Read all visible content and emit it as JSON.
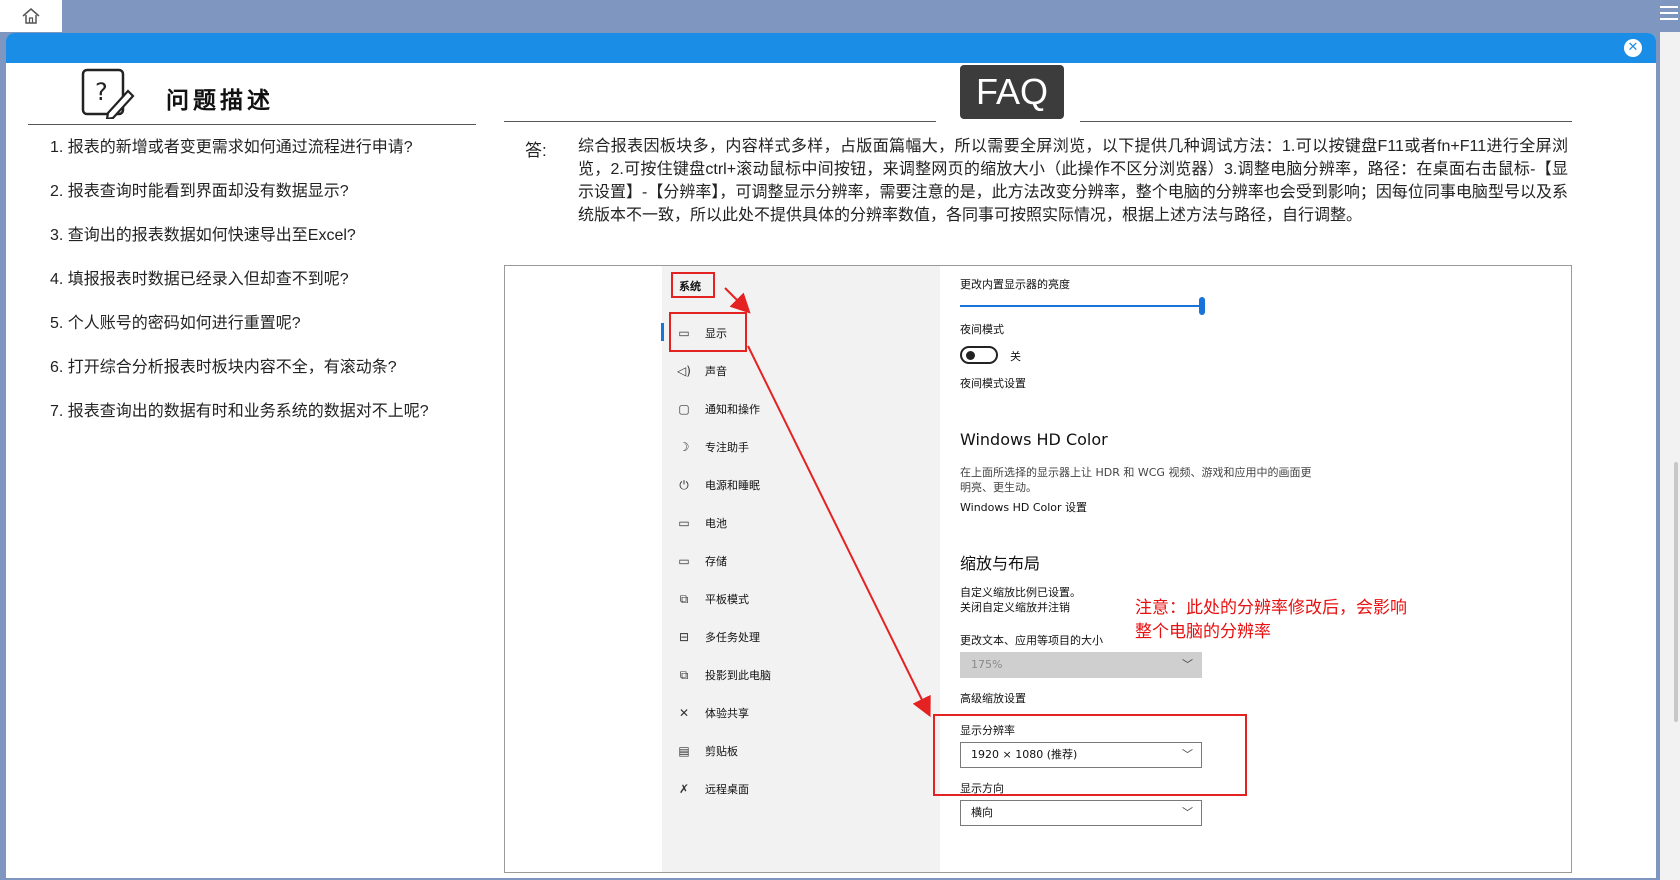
{
  "topbar": {
    "home_icon": "home-icon",
    "menu_icon": "hamburger-menu-icon"
  },
  "modal": {
    "close_icon": "close-icon",
    "close_glyph": "✕"
  },
  "questions": {
    "title": "问题描述",
    "icon": "question-note-icon",
    "items": [
      "1. 报表的新增或者变更需求如何通过流程进行申请?",
      "2. 报表查询时能看到界面却没有数据显示?",
      "3. 查询出的报表数据如何快速导出至Excel?",
      "4. 填报报表时数据已经录入但却查不到呢?",
      "5. 个人账号的密码如何进行重置呢?",
      "6. 打开综合分析报表时板块内容不全，有滚动条?",
      "7. 报表查询出的数据有时和业务系统的数据对不上呢?"
    ]
  },
  "faq": {
    "badge": "FAQ",
    "answer_label": "答:",
    "answer_text": "综合报表因板块多，内容样式多样，占版面篇幅大，所以需要全屏浏览，以下提供几种调试方法：1.可以按键盘F11或者fn+F11进行全屏浏览，2.可按住键盘ctrl+滚动鼠标中间按钮，来调整网页的缩放大小（此操作不区分浏览器）3.调整电脑分辨率，路径：在桌面右击鼠标-【显示设置】-【分辨率】，可调整显示分辨率，需要注意的是，此方法改变分辨率，整个电脑的分辨率也会受到影响；因每位同事电脑型号以及系统版本不一致，所以此处不提供具体的分辨率数值，各同事可按照实际情况，根据上述方法与路径，自行调整。"
  },
  "screenshot": {
    "sidebar_header": "系统",
    "sidebar_items": [
      {
        "label": "显示",
        "icon": "monitor-icon",
        "glyph": "▭"
      },
      {
        "label": "声音",
        "icon": "speaker-icon",
        "glyph": "◁)"
      },
      {
        "label": "通知和操作",
        "icon": "notification-icon",
        "glyph": "▢"
      },
      {
        "label": "专注助手",
        "icon": "moon-icon",
        "glyph": "☽"
      },
      {
        "label": "电源和睡眠",
        "icon": "power-icon",
        "glyph": "⏻"
      },
      {
        "label": "电池",
        "icon": "battery-icon",
        "glyph": "▭"
      },
      {
        "label": "存储",
        "icon": "storage-icon",
        "glyph": "▭"
      },
      {
        "label": "平板模式",
        "icon": "tablet-icon",
        "glyph": "⧉"
      },
      {
        "label": "多任务处理",
        "icon": "multitask-icon",
        "glyph": "⊟"
      },
      {
        "label": "投影到此电脑",
        "icon": "project-icon",
        "glyph": "⧉"
      },
      {
        "label": "体验共享",
        "icon": "share-icon",
        "glyph": "✕"
      },
      {
        "label": "剪贴板",
        "icon": "clipboard-icon",
        "glyph": "▤"
      },
      {
        "label": "远程桌面",
        "icon": "remote-icon",
        "glyph": "✗"
      }
    ],
    "brightness_label": "更改内置显示器的亮度",
    "night_mode_label": "夜间模式",
    "night_mode_state": "关",
    "night_mode_link": "夜间模式设置",
    "hd_color_heading": "Windows HD Color",
    "hd_color_desc_1": "在上面所选择的显示器上让 HDR 和 WCG 视频、游戏和应用中的画面更",
    "hd_color_desc_2": "明亮、更生动。",
    "hd_color_link": "Windows HD Color 设置",
    "scale_heading": "缩放与布局",
    "custom_scale_warning": "自定义缩放比例已设置。",
    "custom_scale_link": "关闭自定义缩放并注销",
    "text_size_label": "更改文本、应用等项目的大小",
    "text_size_value": "175%",
    "advanced_scale_link": "高级缩放设置",
    "resolution_label": "显示分辨率",
    "resolution_value": "1920 × 1080 (推荐)",
    "orientation_label": "显示方向",
    "orientation_value": "横向",
    "annotation_note": "注意：此处的分辨率修改后，会影响整个电脑的分辨率",
    "chevron_glyph": "﹀"
  }
}
